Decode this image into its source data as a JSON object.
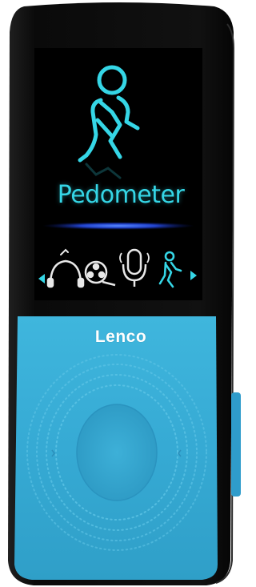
{
  "device": {
    "brand": "Lenco",
    "body_color": "#0d0d0d",
    "front_color": "#3cb0d8",
    "accent_color": "#35d6e6"
  },
  "screen": {
    "title": "Pedometer",
    "menu_icons": [
      "headphones-icon",
      "film-reel-icon",
      "voice-recorder-icon",
      "walking-person-icon"
    ],
    "selected_icon": "walking-person-icon",
    "nav": [
      "arrow-left-icon",
      "arrow-right-icon"
    ]
  }
}
